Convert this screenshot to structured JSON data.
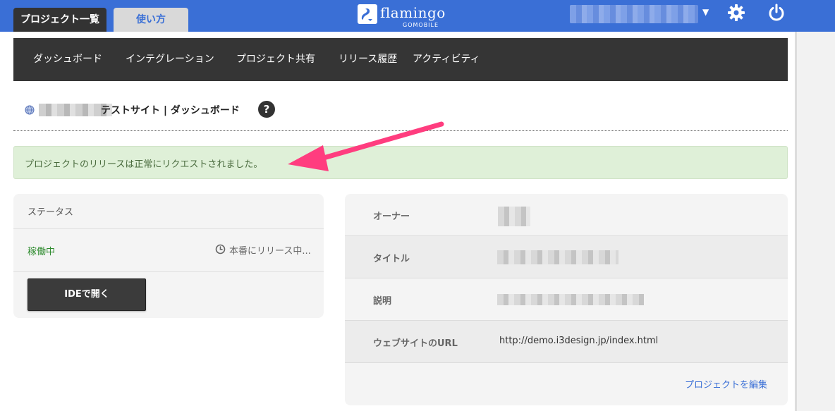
{
  "header": {
    "tabs": [
      {
        "label": "プロジェクト一覧",
        "active": true
      },
      {
        "label": "使い方",
        "active": false
      }
    ],
    "logo": {
      "brand": "flamingo",
      "sub": "GOMOBILE"
    },
    "user_menu_caret": "▼",
    "accent_color": "#3a6fd6"
  },
  "subnav": {
    "items": [
      "ダッシュボード",
      "インテグレーション",
      "プロジェクト共有",
      "リリース履歴",
      "アクティビティ"
    ]
  },
  "page": {
    "title": "テストサイト | ダッシュボード",
    "help_label": "?"
  },
  "alert": {
    "message": "プロジェクトのリリースは正常にリクエストされました。",
    "color": "#dff0d8"
  },
  "status_panel": {
    "header": "ステータス",
    "state": "稼働中",
    "state_color": "#2e8b2e",
    "release_status": "本番にリリース中...",
    "ide_button": "IDEで開く"
  },
  "info_panel": {
    "rows": [
      {
        "label": "オーナー",
        "value": ""
      },
      {
        "label": "タイトル",
        "value": ""
      },
      {
        "label": "説明",
        "value": ""
      },
      {
        "label": "ウェブサイトのURL",
        "value": "http://demo.i3design.jp/index.html"
      }
    ],
    "edit_link": "プロジェクトを編集"
  },
  "annotation": {
    "color": "#ff3d7f"
  }
}
